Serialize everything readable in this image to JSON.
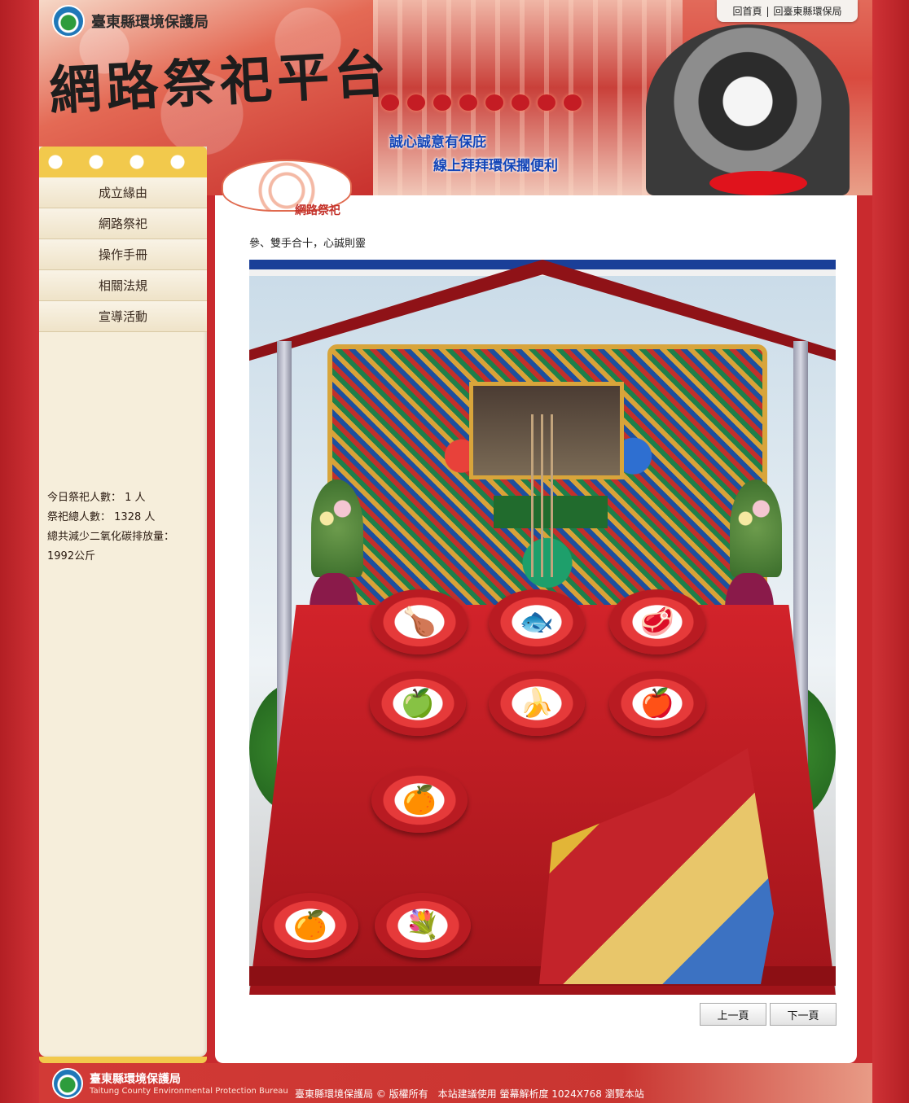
{
  "header": {
    "agency_name": "臺東縣環境保護局",
    "brand_title": "網路祭祀平台",
    "slogan_line1": "誠心誠意有保庇",
    "slogan_line2": "線上拜拜環保擱便利",
    "top_links": [
      "回首頁",
      "回臺東縣環保局"
    ],
    "top_links_separator": "|"
  },
  "sidebar": {
    "nav": [
      "成立緣由",
      "網路祭祀",
      "操作手冊",
      "相關法規",
      "宣導活動"
    ],
    "stats": {
      "today_label": "今日祭祀人數：",
      "today_value": "1 人",
      "total_label": "祭祀總人數：",
      "total_value": "1328 人",
      "co2_label": "總共減少二氧化碳排放量：",
      "co2_value": "1992公斤"
    }
  },
  "main": {
    "section_badge": "網路祭祀",
    "step_text": "參、雙手合十，心誠則靈",
    "offerings": {
      "row1": [
        "chicken-icon",
        "fish-icon",
        "pork-icon"
      ],
      "row2": [
        "guava-icon",
        "banana-icon",
        "apple-icon"
      ],
      "row3": [
        "orange-icon"
      ],
      "bottom": [
        "orange-stack-icon",
        "orchid-icon"
      ]
    }
  },
  "pager": {
    "prev_label": "上一頁",
    "next_label": "下一頁"
  },
  "footer": {
    "org_name": "臺東縣環境保護局",
    "org_name_en": "Taitung County Environmental Protection Bureau",
    "copyright": "臺東縣環境保護局 © 版權所有　本站建議使用 螢幕解析度 1024X768 瀏覽本站"
  },
  "colors": {
    "page_bg": "#c92a2e",
    "sidebar_bg": "#f6eedb",
    "accent_blue": "#1446b8",
    "table_red": "#d2232a"
  }
}
